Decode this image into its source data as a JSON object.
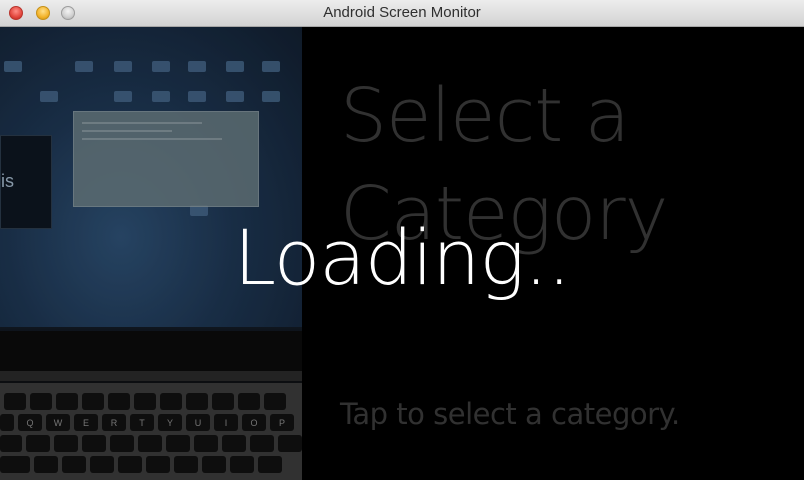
{
  "window": {
    "title": "Android Screen Monitor"
  },
  "screen": {
    "camera_photo_text": "is",
    "card": {
      "title": "Select a Category",
      "hint": "Tap to select a category."
    },
    "loading_text": "Loading..",
    "keyboard_keys": [
      "Q",
      "W",
      "E",
      "R",
      "T",
      "Y",
      "U",
      "I",
      "O",
      "P"
    ]
  },
  "colors": {
    "titlebar": "#e2e2e2",
    "background": "#000000",
    "card_text": "#3a3a3a",
    "loading_text": "#ffffff"
  }
}
